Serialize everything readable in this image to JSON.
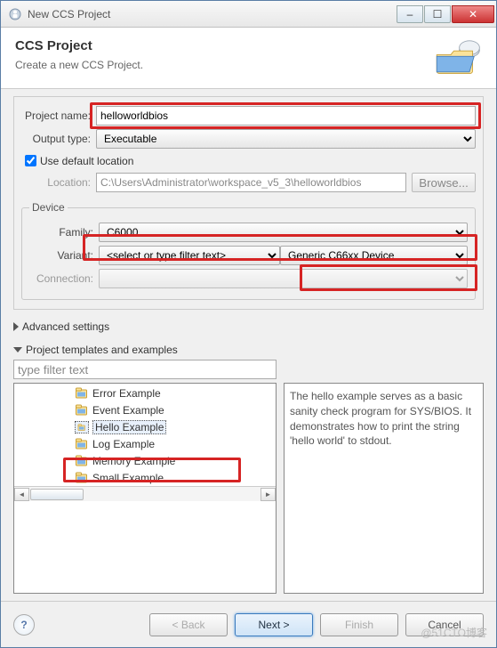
{
  "window": {
    "title": "New CCS Project"
  },
  "header": {
    "title": "CCS Project",
    "subtitle": "Create a new CCS Project."
  },
  "project": {
    "name_label": "Project name:",
    "name_value": "helloworldbios",
    "output_label": "Output type:",
    "output_value": "Executable",
    "use_default_label": "Use default location",
    "use_default_checked": true,
    "location_label": "Location:",
    "location_value": "C:\\Users\\Administrator\\workspace_v5_3\\helloworldbios",
    "browse_label": "Browse..."
  },
  "device": {
    "legend": "Device",
    "family_label": "Family:",
    "family_value": "C6000",
    "variant_label": "Variant:",
    "variant_filter_placeholder": "<select or type filter text>",
    "variant_value": "Generic C66xx Device",
    "connection_label": "Connection:",
    "connection_value": ""
  },
  "sections": {
    "advanced_label": "Advanced settings",
    "templates_label": "Project templates and examples"
  },
  "templates": {
    "filter_placeholder": "type filter text",
    "items": [
      "Error Example",
      "Event Example",
      "Hello Example",
      "Log Example",
      "Memory Example",
      "Small Example"
    ],
    "selected_index": 2,
    "description": "The hello example serves as a basic sanity check program for SYS/BIOS. It demonstrates how to print the string 'hello world' to stdout."
  },
  "buttons": {
    "back": "< Back",
    "next": "Next >",
    "finish": "Finish",
    "cancel": "Cancel"
  },
  "watermark": "@51CTO博客"
}
